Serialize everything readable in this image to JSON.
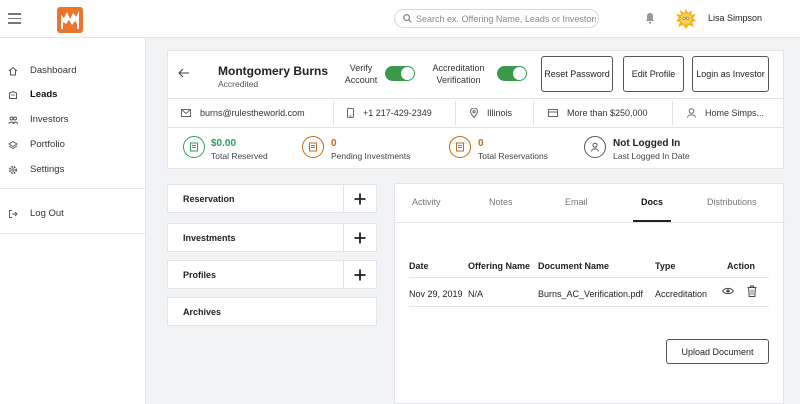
{
  "topbar": {
    "search_placeholder": "Search ex. Offering Name, Leads or Investors",
    "user_name": "Lisa Simpson"
  },
  "sidebar": {
    "items": [
      {
        "label": "Dashboard",
        "icon": "home-icon",
        "active": false
      },
      {
        "label": "Leads",
        "icon": "leads-icon",
        "active": true
      },
      {
        "label": "Investors",
        "icon": "investors-icon",
        "active": false
      },
      {
        "label": "Portfolio",
        "icon": "portfolio-icon",
        "active": false
      },
      {
        "label": "Settings",
        "icon": "gear-icon",
        "active": false
      },
      {
        "label": "Log Out",
        "icon": "logout-icon",
        "active": false
      }
    ]
  },
  "profile": {
    "name": "Montgomery Burns",
    "status": "Accredited",
    "verify_account_label": "Verify Account",
    "verify_account_on": true,
    "accreditation_label": "Accreditation Verification",
    "accreditation_on": true,
    "buttons": {
      "reset_password": "Reset Password",
      "edit_profile": "Edit Profile",
      "login_as_investor": "Login as Investor"
    }
  },
  "info": {
    "email": "burns@rulestheworld.com",
    "phone": "+1 217-429-2349",
    "state": "Illinois",
    "net_worth": "More than $250,000",
    "company": "Home Simps..."
  },
  "stats": {
    "total_reserved": {
      "value": "$0.00",
      "label": "Total Reserved"
    },
    "pending_investments": {
      "value": "0",
      "label": "Pending Investments"
    },
    "total_reservations": {
      "value": "0",
      "label": "Total Reservations"
    },
    "login_status": {
      "value": "Not Logged In",
      "label": "Last Logged In Date"
    }
  },
  "accordion": [
    {
      "label": "Reservation"
    },
    {
      "label": "Investments"
    },
    {
      "label": "Profiles"
    },
    {
      "label": "Archives"
    }
  ],
  "tabs": [
    {
      "label": "Activity"
    },
    {
      "label": "Notes"
    },
    {
      "label": "Email"
    },
    {
      "label": "Docs"
    },
    {
      "label": "Distributions"
    }
  ],
  "active_tab": "Docs",
  "docs_table": {
    "columns": [
      "Date",
      "Offering Name",
      "Document Name",
      "Type",
      "Action"
    ],
    "rows": [
      {
        "date": "Nov 29, 2019",
        "offering": "N/A",
        "document": "Burns_AC_Verification.pdf",
        "type": "Accreditation"
      }
    ]
  },
  "upload_button": "Upload Document",
  "colors": {
    "green": "#2e9e5b",
    "orange": "#c06a1c",
    "toggle": "#3a9a49",
    "logo": "#e8762c"
  }
}
